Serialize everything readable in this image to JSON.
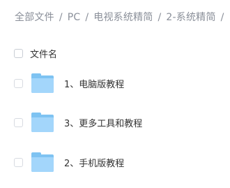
{
  "breadcrumb": {
    "items": [
      "全部文件",
      "PC",
      "电视系统精简",
      "2-系统精简"
    ],
    "separator": "/"
  },
  "list": {
    "header_label": "文件名",
    "rows": [
      {
        "name": "1、电脑版教程",
        "icon": "folder-icon"
      },
      {
        "name": "3、更多工具和教程",
        "icon": "folder-icon"
      },
      {
        "name": "2、手机版教程",
        "icon": "folder-icon"
      }
    ]
  },
  "colors": {
    "folder_back": "#7ec3f2",
    "folder_front": "#a3d6fb",
    "breadcrumb_text": "#8a8f99"
  }
}
